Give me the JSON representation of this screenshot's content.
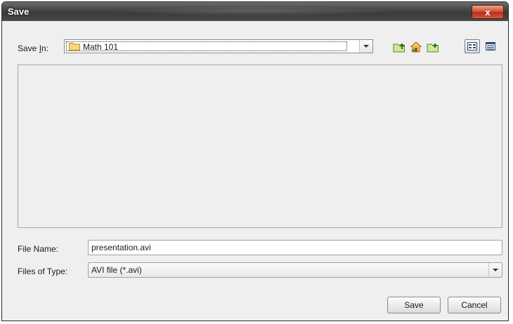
{
  "window": {
    "title": "Save",
    "close_label": "x"
  },
  "save_in": {
    "label_prefix": "Save ",
    "label_mnemonic": "I",
    "label_suffix": "n:",
    "value": "Math 101"
  },
  "toolbar": {
    "icons": [
      "up-one-level-icon",
      "home-icon",
      "new-folder-icon",
      "list-view-icon",
      "details-view-icon"
    ]
  },
  "file_name": {
    "label": "File Name:",
    "value": "presentation.avi"
  },
  "file_type": {
    "label": "Files of Type:",
    "value": "AVI file (*.avi)"
  },
  "buttons": {
    "save": "Save",
    "cancel": "Cancel"
  }
}
